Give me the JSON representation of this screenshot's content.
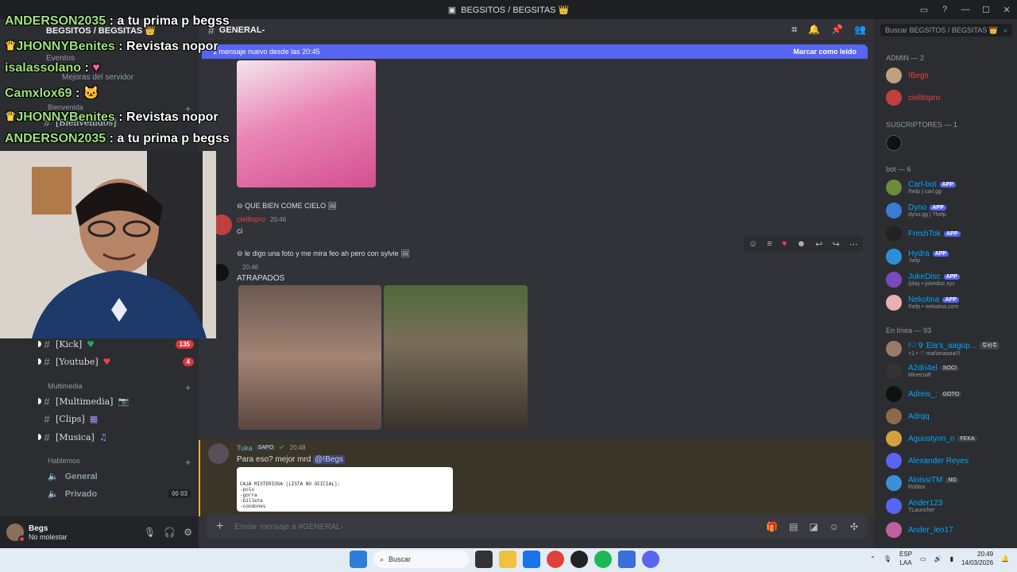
{
  "window": {
    "title": "BEGSITOS / BEGSITAS 👑"
  },
  "server": {
    "name": "BEGSITOS / BEGSITAS 👑",
    "events": "Eventos",
    "boost": "Mejoras del servidor"
  },
  "sidebar": {
    "categories": [
      {
        "label": "Bienvenida"
      },
      {
        "label": "Multimedia"
      },
      {
        "label": "Hablemos"
      }
    ],
    "channels": [
      {
        "label": "[Bienvenidos]"
      },
      {
        "label": "[Kick]",
        "badge": "135"
      },
      {
        "label": "[Youtube]",
        "badge": "4"
      },
      {
        "label": "[Multimedia]"
      },
      {
        "label": "[Clips]"
      },
      {
        "label": "[Musica]"
      }
    ],
    "voice": [
      {
        "label": "General"
      },
      {
        "label": "Privado",
        "counts": "00 03"
      }
    ]
  },
  "user": {
    "name": "Begs",
    "status": "No molestar"
  },
  "channel": {
    "name": "GENERAL-"
  },
  "banner": {
    "text": "1 mensaje nuevo desde las 20:45",
    "mark_read": "Marcar como leído"
  },
  "messages": [
    {
      "reply": "QUE BIEN COME CIELO",
      "author": "cielitopro",
      "time": "20:46",
      "text": "ci"
    },
    {
      "reply": "le digo una foto y me mira feo ah pero con sylvie",
      "time": "20:46",
      "text": "ATRAPADOS"
    },
    {
      "author": "Tuka",
      "tag": "SAPO",
      "time": "20:48",
      "text": "Para eso? mejor mrd",
      "mention": "@!Begs"
    }
  ],
  "doc_preview": {
    "title": "CAJA MISTERIOSA (LISTA NO OFICIAL):",
    "lines": [
      "-polo",
      "-gorra",
      "-billete",
      "-condones"
    ]
  },
  "input": {
    "placeholder": "Enviar mensaje a #GENERAL-"
  },
  "members": {
    "search_placeholder": "Buscar BEGSITOS / BEGSITAS 👑",
    "groups": [
      {
        "label": "ADMIN — 2",
        "items": [
          {
            "name": "!Begs",
            "color": "#f23f43"
          },
          {
            "name": "cielitopro",
            "color": "#f23f43"
          }
        ]
      },
      {
        "label": "SUSCRIPTORES — 1",
        "items": [
          {
            "name": "",
            "color": "#dbdee1"
          }
        ]
      },
      {
        "label": "bot — 6",
        "items": [
          {
            "name": "Carl-bot",
            "sub": "/help | carl.gg",
            "app": "APP"
          },
          {
            "name": "Dyno",
            "sub": "dyno.gg | ?help",
            "app": "APP"
          },
          {
            "name": "FreshTok",
            "sub": "",
            "app": "APP"
          },
          {
            "name": "Hydra",
            "sub": ".help",
            "app": "APP"
          },
          {
            "name": "JukeDisc",
            "sub": "/play • jukedisc.xyz",
            "app": "APP"
          },
          {
            "name": "Nekotina",
            "sub": "!help • nekotina.com",
            "app": "APP"
          }
        ]
      },
      {
        "label": "En línea — 93",
        "items": [
          {
            "name": "!♡✞ Ela's_aagup...",
            "sub": "+1 • ♡ mañanaaaa!!!",
            "tag": "투바투"
          },
          {
            "name": "A2dri4el",
            "sub": "Minecraft",
            "tag": "SOCI"
          },
          {
            "name": "Adreis_:",
            "sub": "",
            "tag": "GOTO"
          },
          {
            "name": "Adrqq",
            "sub": ""
          },
          {
            "name": "Aguustynn_n",
            "sub": "",
            "tag": "FEKA"
          },
          {
            "name": "Alexander Reyes",
            "sub": ""
          },
          {
            "name": "AloissiTM",
            "sub": "Roblox",
            "tag": "NG"
          },
          {
            "name": "Ander123",
            "sub": "TLauncher"
          },
          {
            "name": "Ander_leo17",
            "sub": ""
          }
        ]
      }
    ]
  },
  "overlay_chat": [
    {
      "who": "ANDERSON2035",
      "text": ": a tu prima p begss"
    },
    {
      "who": "JHONNYBenites",
      "text": ": Revistas nopor"
    },
    {
      "who": "isalassolano",
      "text": ":"
    },
    {
      "who": "Camxlox69",
      "text": ":"
    },
    {
      "who": "JHONNYBenites",
      "text": ": Revistas nopor"
    },
    {
      "who": "ANDERSON2035",
      "text": ": a tu prima p begss"
    }
  ],
  "taskbar": {
    "search": "Buscar",
    "lang": "ESP",
    "lang2": "LAA",
    "time": "20:49",
    "date": "14/03/2026"
  }
}
